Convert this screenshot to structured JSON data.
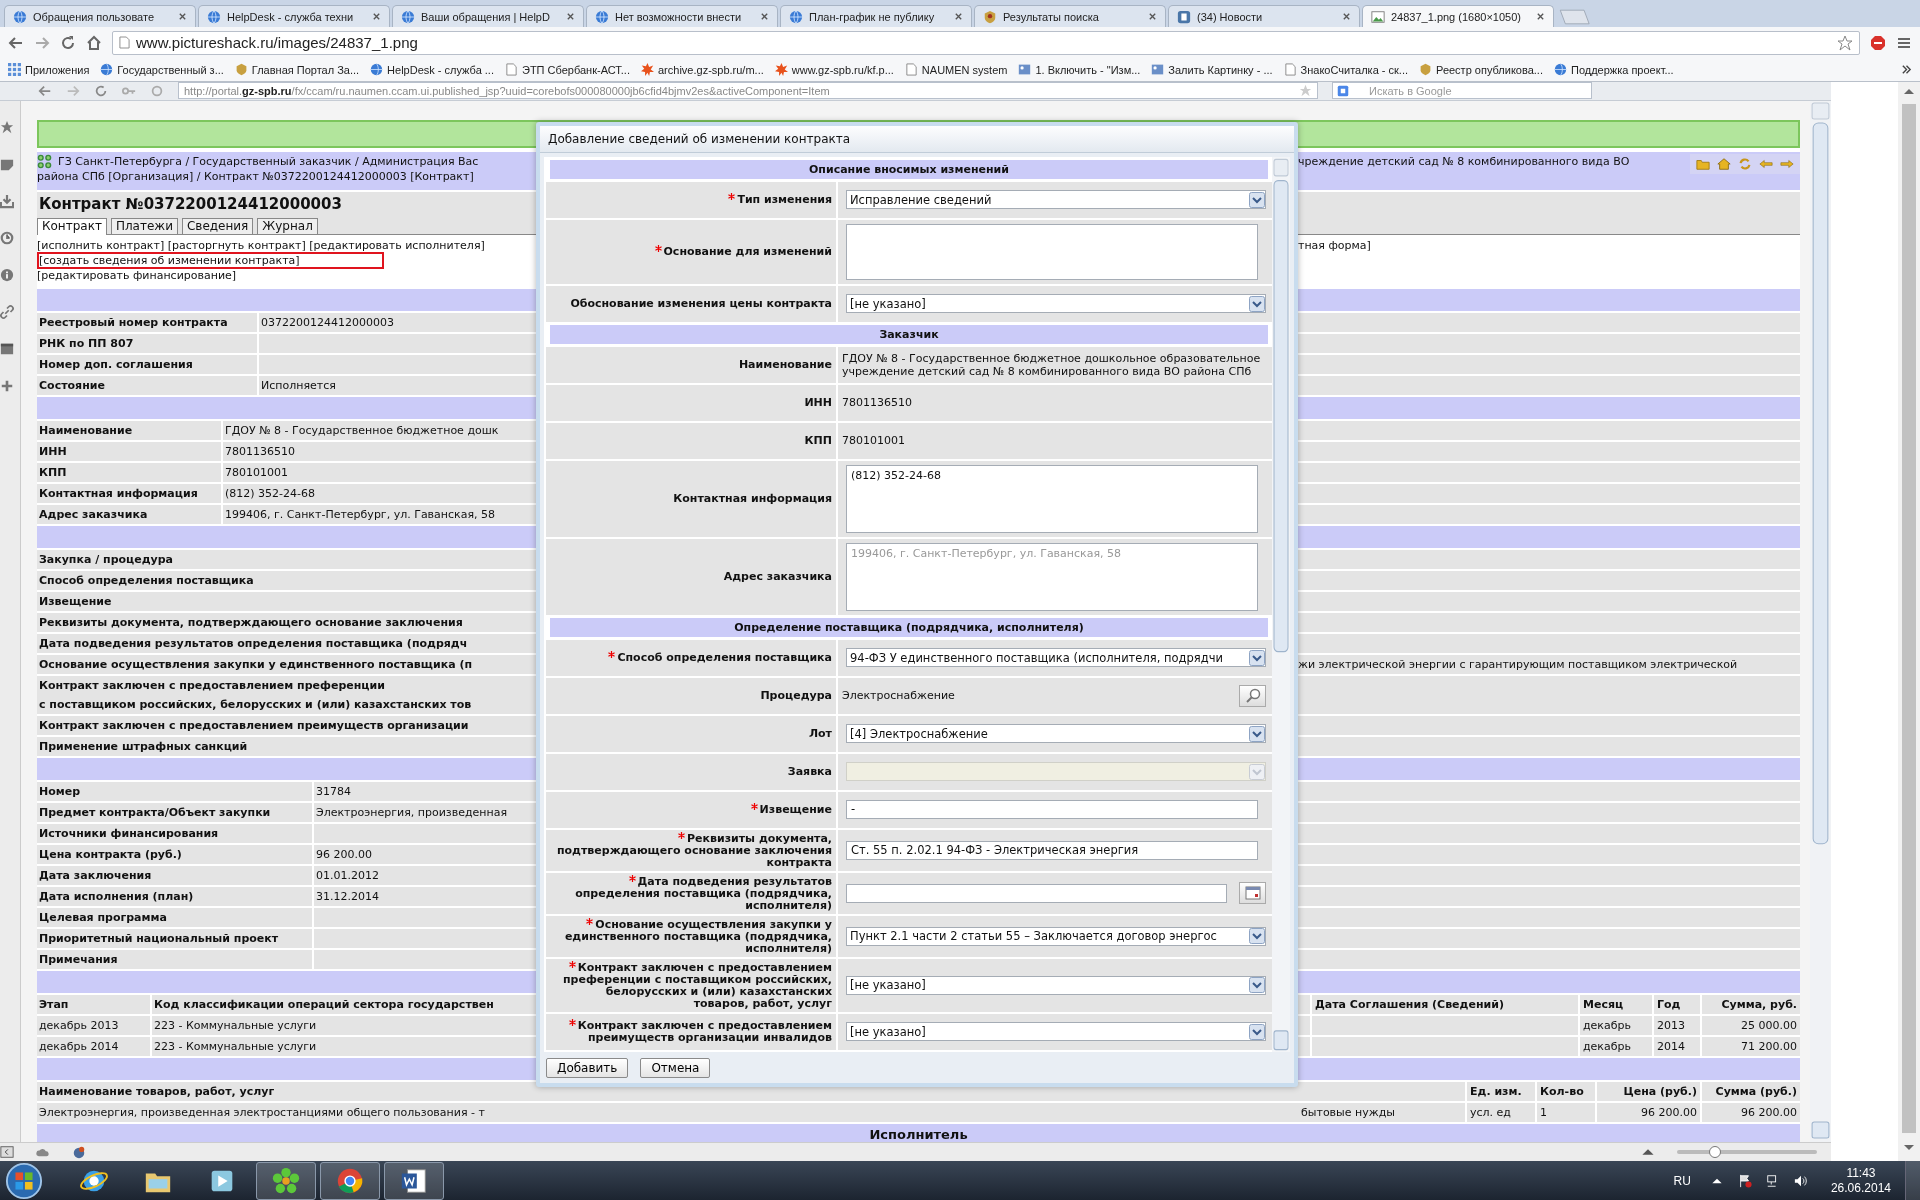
{
  "browser": {
    "tabs": [
      {
        "title": "Обращения пользовате",
        "selected": false
      },
      {
        "title": "HelpDesk - служба техни",
        "selected": false
      },
      {
        "title": "Ваши обращения | HelpD",
        "selected": false
      },
      {
        "title": "Нет возможности внести",
        "selected": false
      },
      {
        "title": "План-график не публику",
        "selected": false
      },
      {
        "title": "Результаты поиска",
        "selected": false
      },
      {
        "title": "(34) Новости",
        "selected": false
      },
      {
        "title": "24837_1.png (1680×1050)",
        "selected": true
      }
    ],
    "address": "www.pictureshack.ru/images/24837_1.png",
    "bookmarks": [
      "Приложения",
      "Государственный з...",
      "Главная Портал За...",
      "HelpDesk - служба ...",
      "ЭТП Сбербанк-АСТ...",
      "archive.gz-spb.ru/m...",
      "www.gz-spb.ru/kf.p...",
      "NAUMEN system",
      "1. Включить - \"Изм...",
      "Залить Картинку - ...",
      "ЗнакоСчиталка - ск...",
      "Реестр опубликова...",
      "Поддержка проект..."
    ]
  },
  "viewer": {
    "url": "http://portal.**gz-spb.ru**/fx/ccam/ru.naumen.ccam.ui.published_jsp?uuid=corebofs000080000jb6cfid4bjmv2es&activeComponent=Item",
    "search_placeholder": "Искать в Google",
    "page": {
      "breadcrumb": [
        "ГЗ Санкт-Петербурга / Государственный заказчик / Администрация Вас",
        "района СПб [Организация] / Контракт №0372200124412000003 [Контракт]"
      ],
      "breadcrumb_continuation": "чреждение детский сад № 8 комбинированного вида ВО",
      "title": "Контракт №0372200124412000003",
      "tabs": [
        {
          "label": "Контракт",
          "selected": true
        },
        {
          "label": "Платежи",
          "selected": false
        },
        {
          "label": "Сведения",
          "selected": false
        },
        {
          "label": "Журнал",
          "selected": false
        }
      ],
      "actions": [
        {
          "text": "[исполнить контракт] [расторгнуть контракт] [редактировать исполнителя]",
          "continuation": "тная форма]",
          "highlighted": false
        },
        {
          "text": "[создать сведения об изменении контракта]",
          "highlighted": true
        },
        {
          "text": "[редактировать финансирование]",
          "highlighted": false
        }
      ],
      "sections": [
        {
          "rows": [
            {
              "label": "Реестровый номер контракта",
              "value": "0372200124412000003"
            },
            {
              "label": "РНК по ПП 807"
            },
            {
              "label": "Номер доп. соглашения"
            },
            {
              "label": "Состояние",
              "value": "Исполняется"
            }
          ]
        },
        {
          "rows": [
            {
              "label": "Наименование",
              "value": "ГДОУ № 8 - Государственное бюджетное дошк"
            },
            {
              "label": "ИНН",
              "value": "7801136510"
            },
            {
              "label": "КПП",
              "value": "780101001"
            },
            {
              "label": "Контактная информация",
              "value": "(812) 352-24-68"
            },
            {
              "label": "Адрес заказчика",
              "value": "199406, г. Санкт-Петербург, ул. Гаванская, 58"
            }
          ]
        },
        {
          "rows": [
            {
              "label": "Закупка / процедура"
            },
            {
              "label": "Способ определения поставщика"
            },
            {
              "label": "Извещение"
            },
            {
              "label": "Реквизиты документа, подтверждающего основание заключения"
            },
            {
              "label": "Дата подведения результатов определения поставщика (подрядч"
            },
            {
              "label": "Основание осуществления закупки у единственного поставщика (п",
              "continuation": "жи электрической энергии с гарантирующим поставщиком электрической"
            },
            {
              "label": "Контракт заключен с предоставлением преференции\nс поставщиком российских, белорусских и (или) казахстанских тов"
            },
            {
              "label": "Контракт заключен с предоставлением преимуществ организации"
            },
            {
              "label": "Применение штрафных санкций"
            }
          ]
        },
        {
          "rows": [
            {
              "label": "Номер",
              "value": "31784"
            },
            {
              "label": "Предмет контракта/Объект закупки",
              "value": "Электроэнергия, произведенная"
            },
            {
              "label": "Источники финансирования"
            },
            {
              "label": "Цена контракта (руб.)",
              "value": "96 200.00"
            },
            {
              "label": "Дата заключения",
              "value": "01.01.2012"
            },
            {
              "label": "Дата исполнения (план)",
              "value": "31.12.2014"
            },
            {
              "label": "Целевая программа"
            },
            {
              "label": "Приоритетный национальный проект"
            },
            {
              "label": "Примечания"
            }
          ]
        }
      ],
      "stages": {
        "columns": [
          "Этап",
          "Код классификации операций сектора государствен"
        ],
        "right_columns": [
          "Дата Соглашения (Сведений)",
          "Месяц",
          "Год",
          "Сумма, руб."
        ],
        "rows": [
          {
            "cells": [
              "декабрь 2013",
              "223 - Коммунальные услуги"
            ],
            "right_cells": [
              "декабрь",
              "2013",
              "25 000.00"
            ]
          },
          {
            "cells": [
              "декабрь 2014",
              "223 - Коммунальные услуги"
            ],
            "right_cells": [
              "декабрь",
              "2014",
              "71 200.00"
            ]
          }
        ]
      },
      "goods": {
        "columns": [
          "Наименование товаров, работ, услуг"
        ],
        "right_columns": [
          "Ед. изм.",
          "Кол-во",
          "Цена (руб.)",
          "Сумма (руб.)"
        ],
        "rows": [
          {
            "cells": [
              "Электроэнергия, произведенная электростанциями общего пользования - т"
            ],
            "continuation": "бытовые нужды",
            "right_cells": [
              "усл. ед",
              "1",
              "96 200.00",
              "96 200.00"
            ]
          }
        ]
      },
      "executor_heading": "Исполнитель"
    },
    "dialog": {
      "title": "Добавление сведений об изменении контракта",
      "sections": [
        {
          "heading": "Описание вносимых изменений",
          "rows": [
            {
              "kind": "select",
              "label": "Тип изменения",
              "required": true,
              "value": "Исправление сведений",
              "disabled": false
            },
            {
              "kind": "textarea",
              "label": "Основание для изменений",
              "required": true,
              "disabled": false
            },
            {
              "kind": "select",
              "label": "Обоснование изменения цены контракта",
              "required": false,
              "value": "[не указано]",
              "disabled": false
            }
          ]
        },
        {
          "heading": "Заказчик",
          "rows": [
            {
              "kind": "static",
              "label": "Наименование",
              "required": false,
              "value": "ГДОУ № 8 - Государственное бюджетное дошкольное образовательное учреждение детский сад № 8 комбинированного вида ВО района СПб"
            },
            {
              "kind": "static",
              "label": "ИНН",
              "required": false,
              "value": "7801136510"
            },
            {
              "kind": "static",
              "label": "КПП",
              "required": false,
              "value": "780101001"
            },
            {
              "kind": "textarea",
              "label": "Контактная информация",
              "required": false,
              "value": "(812) 352-24-68",
              "disabled": false
            },
            {
              "kind": "textarea",
              "label": "Адрес заказчика",
              "required": false,
              "value": "199406, г. Санкт-Петербург, ул. Гаванская, 58",
              "disabled": true
            }
          ]
        },
        {
          "heading": "Определение поставщика (подрядчика, исполнителя)",
          "rows": [
            {
              "kind": "select",
              "label": "Способ определения поставщика",
              "required": true,
              "value": "94-ФЗ У единственного поставщика (исполнителя, подрядчи",
              "disabled": false
            },
            {
              "kind": "lookup",
              "label": "Процедура",
              "required": false,
              "value": "Электроснабжение"
            },
            {
              "kind": "select",
              "label": "Лот",
              "required": false,
              "value": "[4] Электроснабжение",
              "disabled": false
            },
            {
              "kind": "select",
              "label": "Заявка",
              "required": false,
              "disabled": true
            },
            {
              "kind": "input",
              "label": "Извещение",
              "required": true,
              "value": "-"
            },
            {
              "kind": "input",
              "label": "Реквизиты документа, подтверждающего основание заключения контракта",
              "required": true,
              "value": "Ст. 55 п. 2.02.1 94-ФЗ - Электрическая энергия"
            },
            {
              "kind": "date",
              "label": "Дата подведения результатов определения поставщика (подрядчика, исполнителя)",
              "required": true
            },
            {
              "kind": "select",
              "label": "Основание осуществления закупки у единственного поставщика (подрядчика, исполнителя)",
              "required": true,
              "value": "Пункт 2.1 части 2 статьи 55 – Заключается договор энергос",
              "disabled": false
            },
            {
              "kind": "select",
              "label": "Контракт заключен с предоставлением преференции с поставщиком российских, белорусских и (или) казахстанских товаров, работ, услуг",
              "required": true,
              "value": "[не указано]",
              "disabled": false
            },
            {
              "kind": "select",
              "label": "Контракт заключен с предоставлением преимуществ организации инвалидов",
              "required": true,
              "value": "[не указано]",
              "disabled": false
            }
          ]
        }
      ],
      "buttons": [
        "Добавить",
        "Отмена"
      ]
    },
    "zoom": {
      "level": 0.27
    }
  },
  "taskbar": {
    "buttons": [
      {
        "running": false
      },
      {
        "running": false
      },
      {
        "running": false
      },
      {
        "running": true
      },
      {
        "running": true
      },
      {
        "running": true
      }
    ],
    "language": "RU",
    "time": "11:43",
    "date": "26.06.2014"
  }
}
